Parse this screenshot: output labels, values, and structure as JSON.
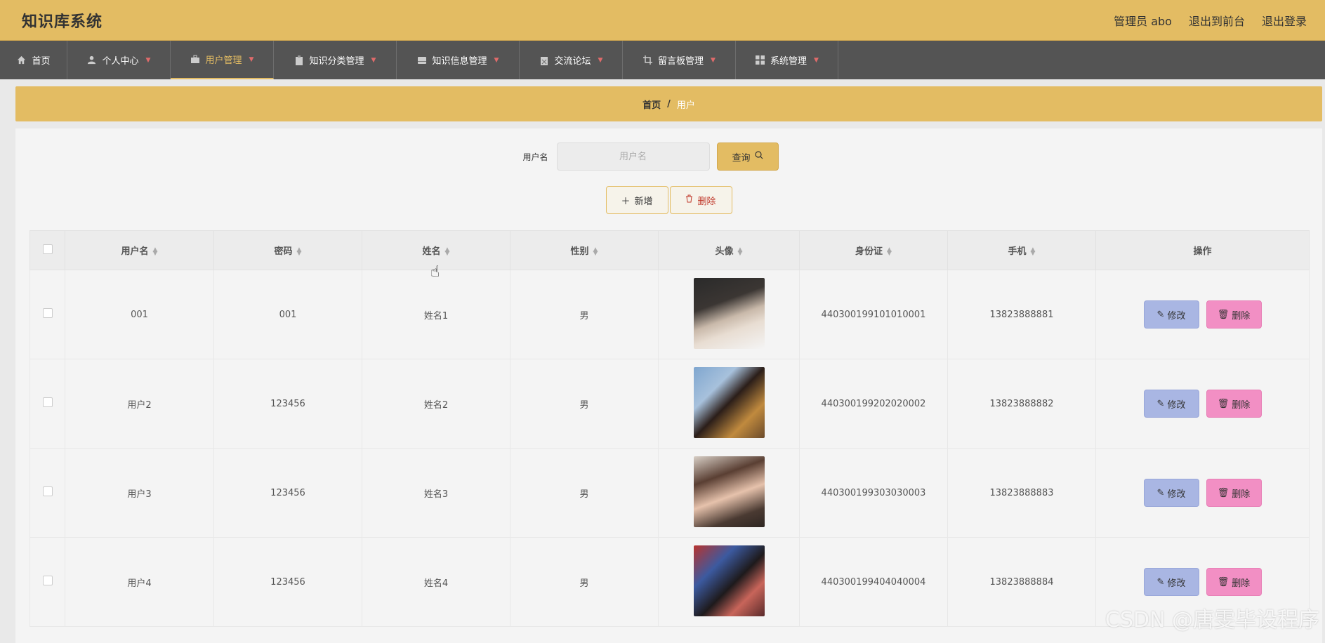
{
  "header": {
    "title": "知识库系统",
    "admin": "管理员 abo",
    "to_front": "退出到前台",
    "logout": "退出登录"
  },
  "nav": {
    "items": [
      {
        "label": "首页",
        "icon": "home-icon"
      },
      {
        "label": "个人中心",
        "icon": "user-icon"
      },
      {
        "label": "用户管理",
        "icon": "briefcase-icon"
      },
      {
        "label": "知识分类管理",
        "icon": "clipboard-icon"
      },
      {
        "label": "知识信息管理",
        "icon": "drive-icon"
      },
      {
        "label": "交流论坛",
        "icon": "calendar-icon"
      },
      {
        "label": "留言板管理",
        "icon": "crop-icon"
      },
      {
        "label": "系统管理",
        "icon": "grid-icon"
      }
    ],
    "active_index": 2
  },
  "breadcrumb": {
    "home": "首页",
    "sep": "/",
    "current": "用户"
  },
  "search": {
    "label": "用户名",
    "placeholder": "用户名",
    "button": "查询"
  },
  "actions": {
    "add": "新增",
    "delete": "删除"
  },
  "table": {
    "headers": [
      "用户名",
      "密码",
      "姓名",
      "性别",
      "头像",
      "身份证",
      "手机",
      "操作"
    ],
    "rows": [
      {
        "username": "001",
        "password": "001",
        "name": "姓名1",
        "gender": "男",
        "id_card": "440300199101010001",
        "phone": "13823888881"
      },
      {
        "username": "用户2",
        "password": "123456",
        "name": "姓名2",
        "gender": "男",
        "id_card": "440300199202020002",
        "phone": "13823888882"
      },
      {
        "username": "用户3",
        "password": "123456",
        "name": "姓名3",
        "gender": "男",
        "id_card": "440300199303030003",
        "phone": "13823888883"
      },
      {
        "username": "用户4",
        "password": "123456",
        "name": "姓名4",
        "gender": "男",
        "id_card": "440300199404040004",
        "phone": "13823888884"
      }
    ],
    "edit_label": "修改",
    "delete_label": "删除"
  },
  "watermark": "CSDN @唐雯毕设程序",
  "colors": {
    "accent": "#e3bc63",
    "nav_bg": "#545454",
    "edit_btn": "#a9b6e3",
    "delete_btn": "#f28fc4"
  }
}
